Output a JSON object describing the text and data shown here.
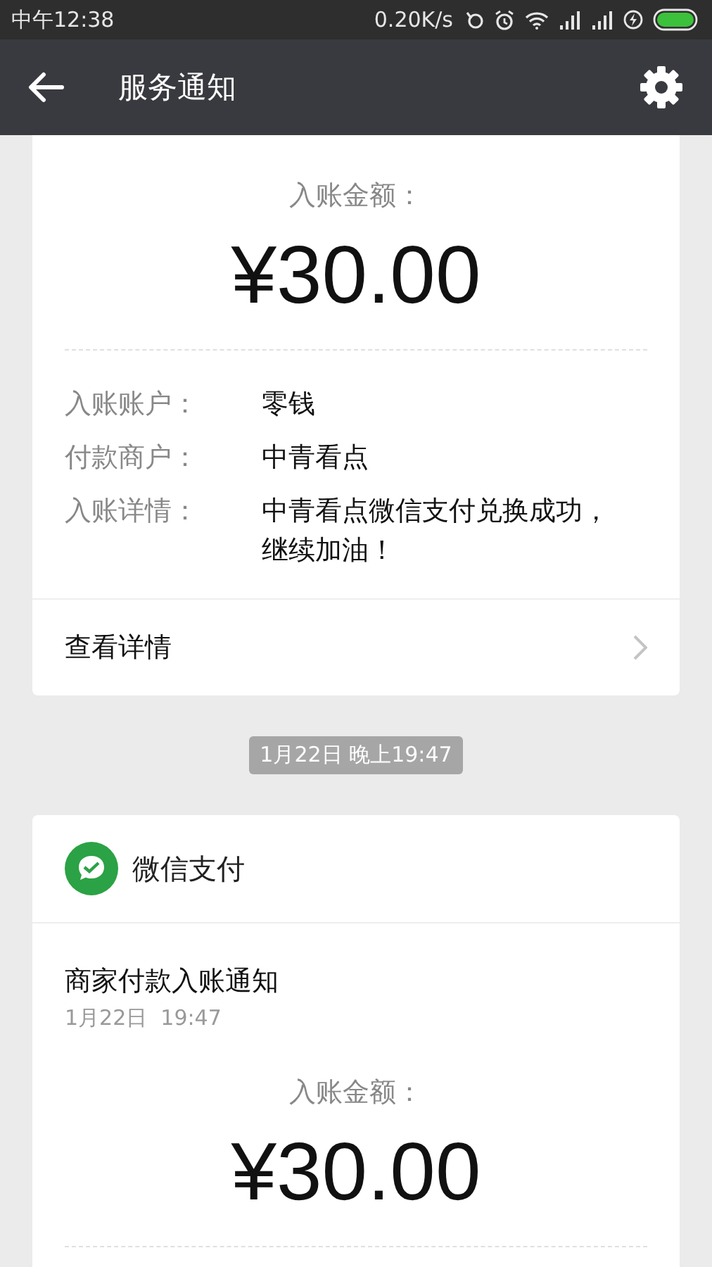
{
  "status_bar": {
    "time": "中午12:38",
    "speed": "0.20K/s"
  },
  "header": {
    "title": "服务通知"
  },
  "card_1": {
    "amount_label": "入账金额：",
    "amount": "¥30.00",
    "fields": [
      {
        "label": "入账账户：",
        "value": "零钱"
      },
      {
        "label": "付款商户：",
        "value": "中青看点"
      },
      {
        "label": "入账详情：",
        "value": "中青看点微信支付兑换成功，继续加油！"
      }
    ],
    "link": "查看详情"
  },
  "timestamp": "1月22日 晚上19:47",
  "card_2": {
    "source": "微信支付",
    "title": "商家付款入账通知",
    "date": "1月22日  19:47",
    "amount_label": "入账金额：",
    "amount": "¥30.00"
  }
}
